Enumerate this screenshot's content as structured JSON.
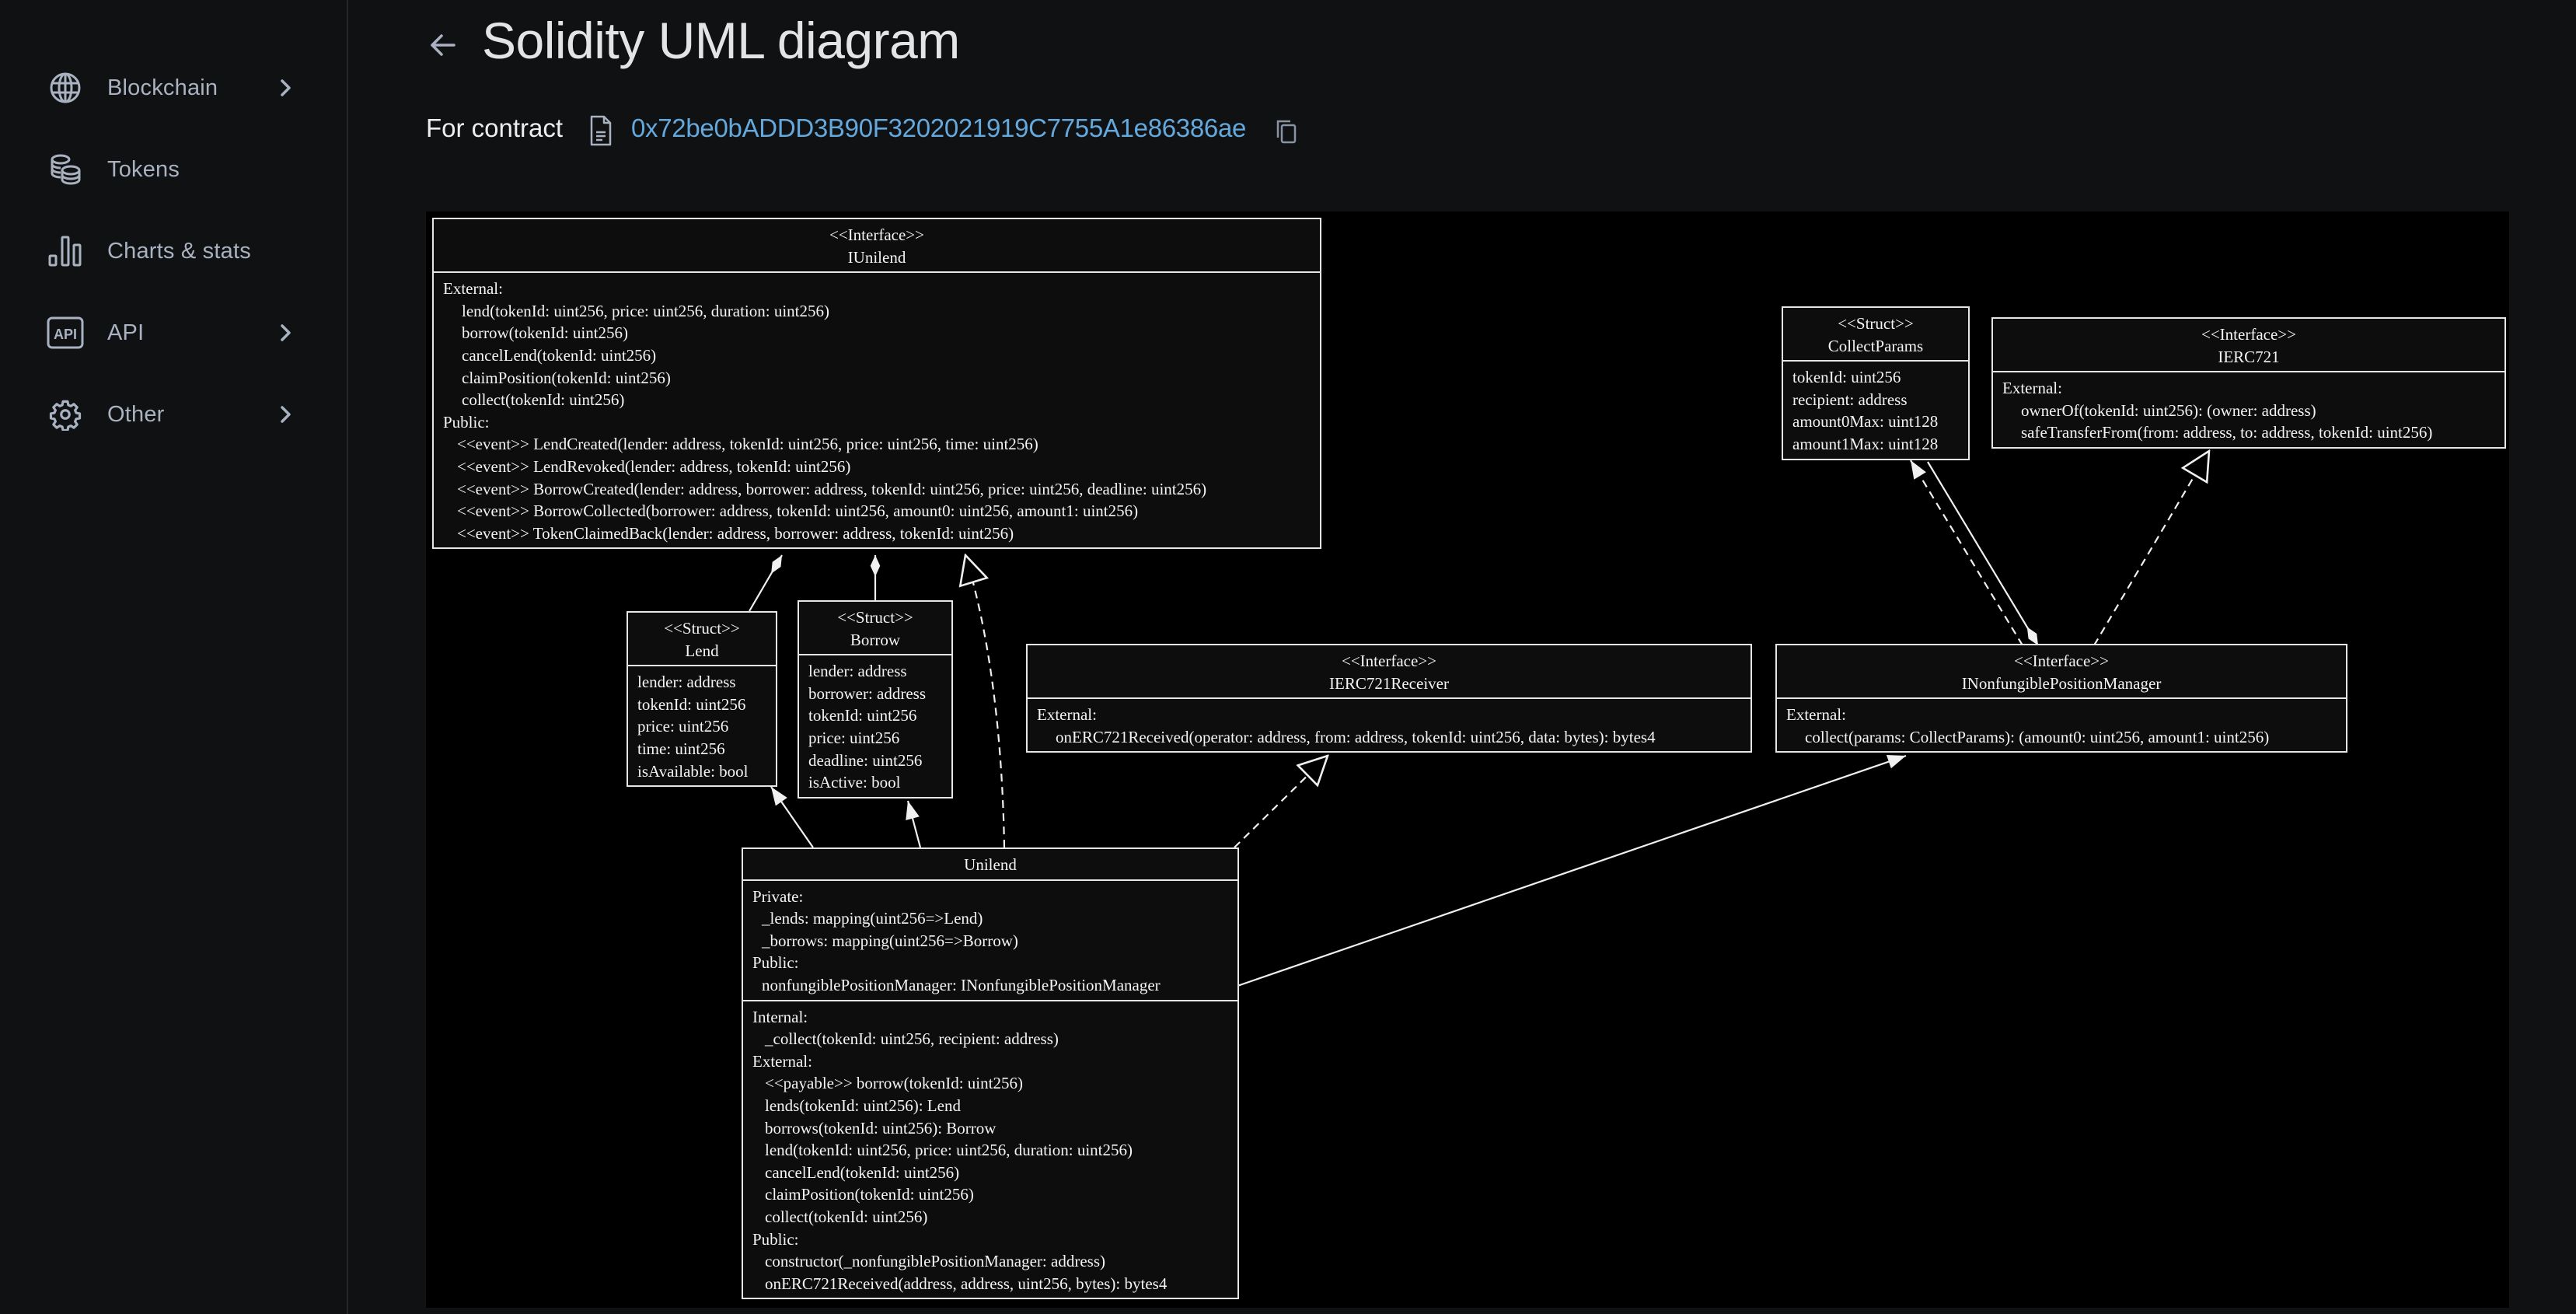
{
  "sidebar": {
    "items": [
      {
        "label": "Blockchain",
        "icon": "globe-icon",
        "has_submenu": true
      },
      {
        "label": "Tokens",
        "icon": "coins-icon",
        "has_submenu": false
      },
      {
        "label": "Charts & stats",
        "icon": "bar-chart-icon",
        "has_submenu": false
      },
      {
        "label": "API",
        "icon": "api-icon",
        "has_submenu": true
      },
      {
        "label": "Other",
        "icon": "gear-icon",
        "has_submenu": true
      }
    ]
  },
  "header": {
    "back_icon": "arrow-left-icon",
    "title": "Solidity UML diagram",
    "for_contract_label": "For contract",
    "contract_address": "0x72be0bADDD3B90F3202021919C7755A1e86386ae",
    "file_icon": "file-icon",
    "copy_icon": "copy-icon"
  },
  "colors": {
    "page_bg": "#101112",
    "canvas_bg": "#000000",
    "node_bg": "#0d0d0d",
    "node_border": "#e6e6e6",
    "link": "#64a9de",
    "sidebar_text": "#a9b2c1"
  },
  "diagram": {
    "nodes": {
      "iunilend": {
        "stereotype": "<<Interface>>",
        "name": "IUnilend",
        "sections": [
          {
            "label": "External:",
            "lines": [
              "lend(tokenId: uint256, price: uint256, duration: uint256)",
              "borrow(tokenId: uint256)",
              "cancelLend(tokenId: uint256)",
              "claimPosition(tokenId: uint256)",
              "collect(tokenId: uint256)"
            ]
          },
          {
            "label": "Public:",
            "lines": [
              "<<event>> LendCreated(lender: address, tokenId: uint256, price: uint256, time: uint256)",
              "<<event>> LendRevoked(lender: address, tokenId: uint256)",
              "<<event>> BorrowCreated(lender: address, borrower: address, tokenId: uint256, price: uint256, deadline: uint256)",
              "<<event>> BorrowCollected(borrower: address, tokenId: uint256, amount0: uint256, amount1: uint256)",
              "<<event>> TokenClaimedBack(lender: address, borrower: address, tokenId: uint256)"
            ]
          }
        ]
      },
      "lend": {
        "stereotype": "<<Struct>>",
        "name": "Lend",
        "fields": [
          "lender: address",
          "tokenId: uint256",
          "price: uint256",
          "time: uint256",
          "isAvailable: bool"
        ]
      },
      "borrow": {
        "stereotype": "<<Struct>>",
        "name": "Borrow",
        "fields": [
          "lender: address",
          "borrower: address",
          "tokenId: uint256",
          "price: uint256",
          "deadline: uint256",
          "isActive: bool"
        ]
      },
      "ierc721receiver": {
        "stereotype": "<<Interface>>",
        "name": "IERC721Receiver",
        "sections": [
          {
            "label": "External:",
            "lines": [
              "onERC721Received(operator: address, from: address, tokenId: uint256, data: bytes): bytes4"
            ]
          }
        ]
      },
      "collectparams": {
        "stereotype": "<<Struct>>",
        "name": "CollectParams",
        "fields": [
          "tokenId: uint256",
          "recipient: address",
          "amount0Max: uint128",
          "amount1Max: uint128"
        ]
      },
      "ierc721": {
        "stereotype": "<<Interface>>",
        "name": "IERC721",
        "sections": [
          {
            "label": "External:",
            "lines": [
              "ownerOf(tokenId: uint256): (owner: address)",
              "safeTransferFrom(from: address, to: address, tokenId: uint256)"
            ]
          }
        ]
      },
      "inpm": {
        "stereotype": "<<Interface>>",
        "name": "INonfungiblePositionManager",
        "sections": [
          {
            "label": "External:",
            "lines": [
              "collect(params: CollectParams): (amount0: uint256, amount1: uint256)"
            ]
          }
        ]
      },
      "unilend": {
        "name": "Unilend",
        "attributes": [
          {
            "label": "Private:",
            "lines": [
              "_lends: mapping(uint256=>Lend)",
              "_borrows: mapping(uint256=>Borrow)"
            ]
          },
          {
            "label": "Public:",
            "lines": [
              "nonfungiblePositionManager: INonfungiblePositionManager"
            ]
          }
        ],
        "operations": [
          {
            "label": "Internal:",
            "lines": [
              "_collect(tokenId: uint256, recipient: address)"
            ]
          },
          {
            "label": "External:",
            "lines": [
              "<<payable>> borrow(tokenId: uint256)",
              "lends(tokenId: uint256): Lend",
              "borrows(tokenId: uint256): Borrow",
              "lend(tokenId: uint256, price: uint256, duration: uint256)",
              "cancelLend(tokenId: uint256)",
              "claimPosition(tokenId: uint256)",
              "collect(tokenId: uint256)"
            ]
          },
          {
            "label": "Public:",
            "lines": [
              "constructor(_nonfungiblePositionManager: address)",
              "onERC721Received(address, address, uint256, bytes): bytes4"
            ]
          }
        ]
      }
    },
    "edges": [
      {
        "from": "lend",
        "to": "iunilend",
        "type": "composition"
      },
      {
        "from": "borrow",
        "to": "iunilend",
        "type": "composition"
      },
      {
        "from": "unilend",
        "to": "iunilend",
        "type": "realization"
      },
      {
        "from": "unilend",
        "to": "lend",
        "type": "association"
      },
      {
        "from": "unilend",
        "to": "borrow",
        "type": "association"
      },
      {
        "from": "unilend",
        "to": "ierc721receiver",
        "type": "realization"
      },
      {
        "from": "unilend",
        "to": "inpm",
        "type": "association"
      },
      {
        "from": "inpm",
        "to": "collectparams",
        "type": "dependency"
      },
      {
        "from": "collectparams",
        "to": "inpm",
        "type": "composition"
      },
      {
        "from": "inpm",
        "to": "ierc721",
        "type": "realization"
      }
    ]
  }
}
